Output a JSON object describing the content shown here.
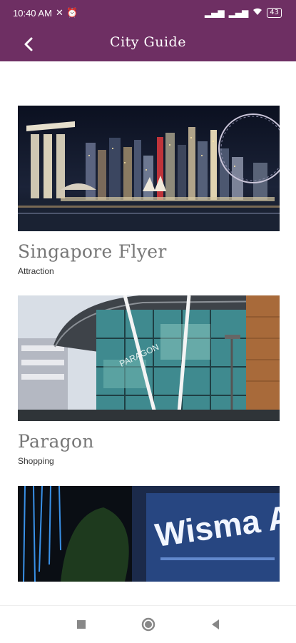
{
  "status_bar": {
    "time": "10:40 AM",
    "battery": "43"
  },
  "app_bar": {
    "title": "City Guide"
  },
  "places": [
    {
      "name": "Singapore Flyer",
      "category": "Attraction"
    },
    {
      "name": "Paragon",
      "category": "Shopping"
    },
    {
      "name": "Wisma Atria",
      "category": ""
    }
  ],
  "colors": {
    "primary": "#6e2f63",
    "name_text": "#777777"
  },
  "icons": {
    "back": "chevron-left-icon",
    "nav_recent": "square-icon",
    "nav_home": "circle-icon",
    "nav_back": "triangle-left-icon"
  }
}
